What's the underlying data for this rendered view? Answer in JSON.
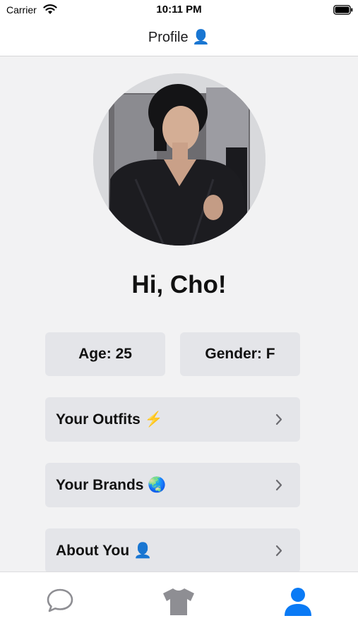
{
  "status_bar": {
    "carrier": "Carrier",
    "time": "10:11 PM"
  },
  "nav": {
    "title": "Profile 👤"
  },
  "profile": {
    "greeting": "Hi, Cho!",
    "age_label": "Age: 25",
    "gender_label": "Gender: F"
  },
  "menu": {
    "items": [
      {
        "label": "Your Outfits ⚡️"
      },
      {
        "label": "Your Brands 🌏"
      },
      {
        "label": "About You 👤"
      }
    ]
  },
  "tab_bar": {
    "items": [
      {
        "icon": "chat-bubble-icon"
      },
      {
        "icon": "shirt-icon"
      },
      {
        "icon": "person-icon",
        "selected": true
      }
    ]
  },
  "colors": {
    "background": "#f2f2f3",
    "card": "#e4e5e9",
    "accent": "#0a7af5",
    "tab_inactive": "#8e8e93"
  }
}
